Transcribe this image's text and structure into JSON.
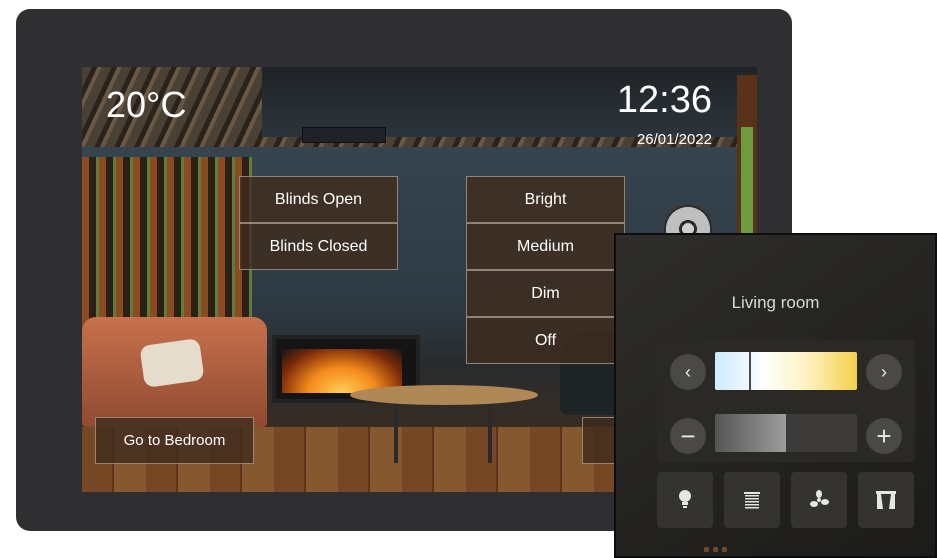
{
  "screen": {
    "temperature": "20°C",
    "time": "12:36",
    "date": "26/01/2022",
    "blinds_buttons": [
      {
        "label": "Blinds Open"
      },
      {
        "label": "Blinds Closed"
      }
    ],
    "light_buttons": [
      {
        "label": "Bright"
      },
      {
        "label": "Medium"
      },
      {
        "label": "Dim"
      },
      {
        "label": "Off"
      }
    ],
    "go_to_bedroom_label": "Go to Bedroom"
  },
  "panel": {
    "room_title": "Living room",
    "prev_icon": "‹",
    "next_icon": "›",
    "minus_icon": "−",
    "plus_icon": "+",
    "brightness_level": 0.5,
    "device_icons": [
      "lightbulb-icon",
      "blinds-icon",
      "fan-icon",
      "curtains-icon"
    ]
  },
  "colors": {
    "tablet_bezel": "#2f2f31",
    "button_bg": "#3e2c1e",
    "panel_bg": "#23221f",
    "accent_warm": "#f2cf4a",
    "accent_cool": "#cfeaff"
  }
}
